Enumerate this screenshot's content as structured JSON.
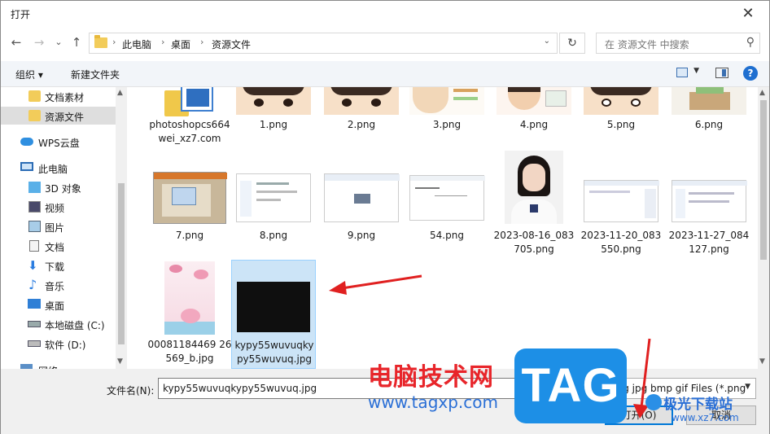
{
  "window": {
    "title": "打开",
    "close_glyph": "✕"
  },
  "nav": {
    "back": "←",
    "forward": "→",
    "dropdown": "⌄",
    "up": "↑",
    "breadcrumb": [
      "此电脑",
      "桌面",
      "资源文件"
    ],
    "refresh": "↻",
    "search_placeholder": "在 资源文件 中搜索"
  },
  "toolbar": {
    "organize": "组织 ▾",
    "new_folder": "新建文件夹",
    "help": "?"
  },
  "sidebar": {
    "items": [
      {
        "label": "文档素材",
        "icon": "folder-icon"
      },
      {
        "label": "资源文件",
        "icon": "folder-icon",
        "selected": true
      },
      {
        "label": "WPS云盘",
        "icon": "cloud-icon"
      },
      {
        "label": "此电脑",
        "icon": "computer-icon"
      },
      {
        "label": "3D 对象",
        "icon": "cube-icon"
      },
      {
        "label": "视频",
        "icon": "video-icon"
      },
      {
        "label": "图片",
        "icon": "picture-icon"
      },
      {
        "label": "文档",
        "icon": "document-icon"
      },
      {
        "label": "下载",
        "icon": "download-icon"
      },
      {
        "label": "音乐",
        "icon": "music-icon"
      },
      {
        "label": "桌面",
        "icon": "desktop-icon"
      },
      {
        "label": "本地磁盘 (C:)",
        "icon": "drive-icon"
      },
      {
        "label": "软件 (D:)",
        "icon": "drive-icon"
      },
      {
        "label": "网络",
        "icon": "network-icon"
      }
    ]
  },
  "files": [
    {
      "name": "photoshopcs664wei_xz7.com"
    },
    {
      "name": "1.png"
    },
    {
      "name": "2.png"
    },
    {
      "name": "3.png"
    },
    {
      "name": "4.png"
    },
    {
      "name": "5.png"
    },
    {
      "name": "6.png"
    },
    {
      "name": "7.png"
    },
    {
      "name": "8.png"
    },
    {
      "name": "9.png"
    },
    {
      "name": "54.png"
    },
    {
      "name": "2023-08-16_083705.png"
    },
    {
      "name": "2023-11-20_083550.png"
    },
    {
      "name": "2023-11-27_084127.png"
    },
    {
      "name": "00081184469 26569_b.jpg"
    },
    {
      "name": "kypy55wuvuqkypy55wuvuq.jpg",
      "selected": true
    }
  ],
  "bottom": {
    "filename_label": "文件名(N):",
    "filename_value": "kypy55wuvuqkypy55wuvuq.jpg",
    "filetype_value": "png jpg bmp gif Files (*.png",
    "open_button": "打开(O)",
    "cancel_button": "取消"
  },
  "overlay": {
    "site_title": "电脑技术网",
    "site_url": "www.tagxp.com",
    "tag_logo": "TAG",
    "wm_title": "极光下载站",
    "wm_url": "www.xz7.com"
  },
  "colors": {
    "accent": "#0078d7",
    "selection": "#cce4f7",
    "arrow": "#e02020",
    "tag_blue": "#1d8fe6",
    "site_red": "#e8252a"
  }
}
